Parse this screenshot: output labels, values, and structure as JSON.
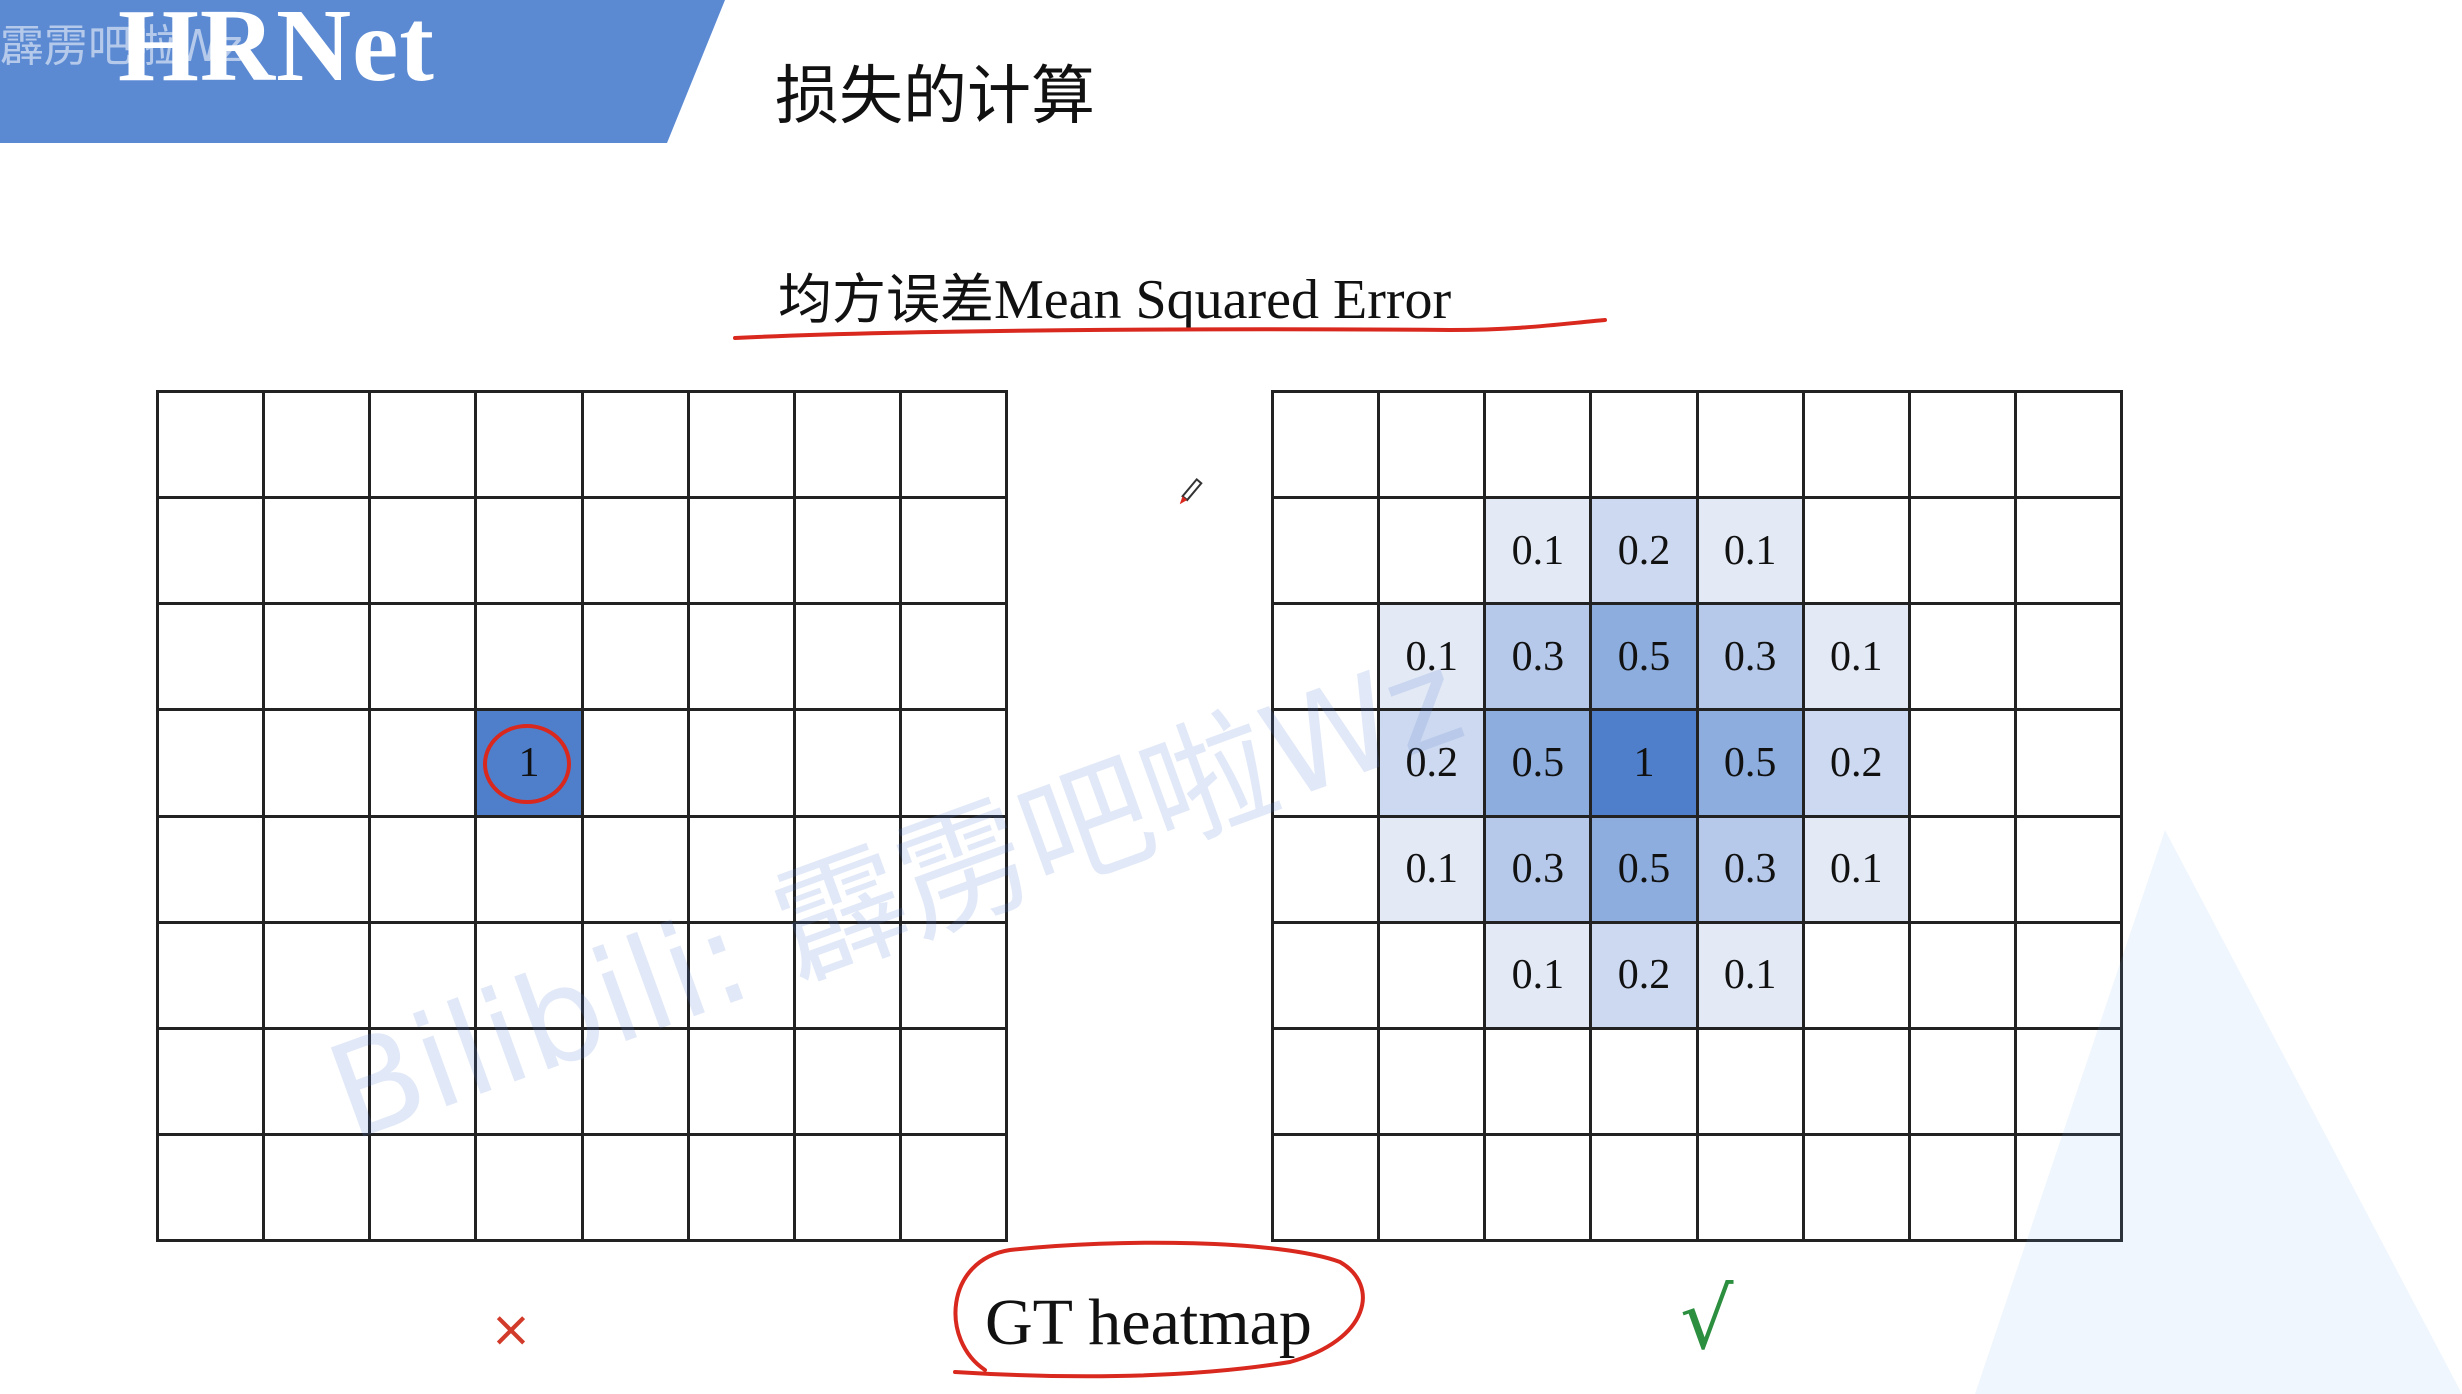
{
  "header": {
    "banner_title": "HRNet",
    "watermark": "霹雳吧啦Wz"
  },
  "slide": {
    "title": "损失的计算",
    "subtitle_cn": "均方误差",
    "subtitle_en": "Mean Squared Error"
  },
  "grid_left": {
    "rows": [
      [
        "",
        "",
        "",
        "",
        "",
        "",
        "",
        ""
      ],
      [
        "",
        "",
        "",
        "",
        "",
        "",
        "",
        ""
      ],
      [
        "",
        "",
        "",
        "",
        "",
        "",
        "",
        ""
      ],
      [
        "",
        "",
        "",
        "1",
        "",
        "",
        "",
        ""
      ],
      [
        "",
        "",
        "",
        "",
        "",
        "",
        "",
        ""
      ],
      [
        "",
        "",
        "",
        "",
        "",
        "",
        "",
        ""
      ],
      [
        "",
        "",
        "",
        "",
        "",
        "",
        "",
        ""
      ],
      [
        "",
        "",
        "",
        "",
        "",
        "",
        "",
        ""
      ]
    ]
  },
  "grid_right": {
    "rows": [
      [
        "",
        "",
        "",
        "",
        "",
        "",
        "",
        ""
      ],
      [
        "",
        "",
        "0.1",
        "0.2",
        "0.1",
        "",
        "",
        ""
      ],
      [
        "",
        "0.1",
        "0.3",
        "0.5",
        "0.3",
        "0.1",
        "",
        ""
      ],
      [
        "",
        "0.2",
        "0.5",
        "1",
        "0.5",
        "0.2",
        "",
        ""
      ],
      [
        "",
        "0.1",
        "0.3",
        "0.5",
        "0.3",
        "0.1",
        "",
        ""
      ],
      [
        "",
        "",
        "0.1",
        "0.2",
        "0.1",
        "",
        "",
        ""
      ],
      [
        "",
        "",
        "",
        "",
        "",
        "",
        "",
        ""
      ],
      [
        "",
        "",
        "",
        "",
        "",
        "",
        "",
        ""
      ]
    ]
  },
  "labels": {
    "cross": "×",
    "check": "√",
    "gt": "GT heatmap"
  },
  "watermark_text": "Bilibili: 霹雳吧啦Wz",
  "colors": {
    "banner": "#5b8ad3",
    "peak_cell": "#4f7fcb",
    "annotation_red": "#d9281e",
    "cross_red": "#d23a2a",
    "check_green": "#2c8f3f"
  }
}
